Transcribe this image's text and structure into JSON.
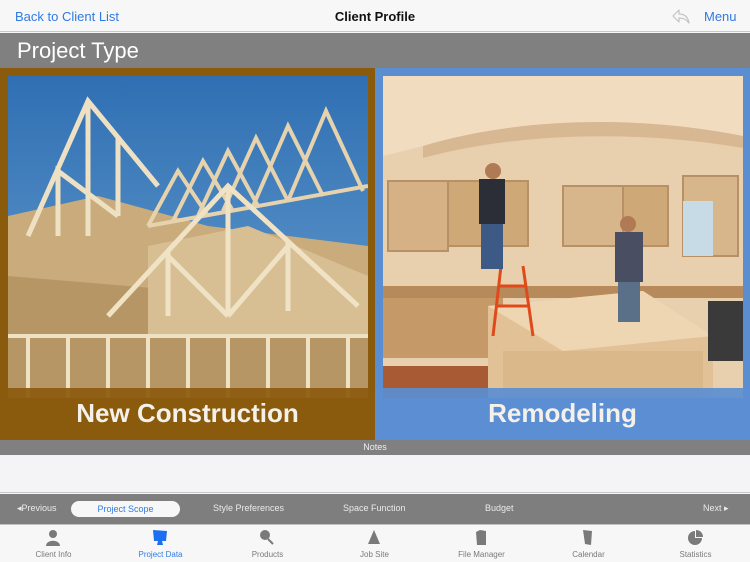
{
  "navbar": {
    "back_label": "Back to Client List",
    "title": "Client Profile",
    "undo_icon": "undo-arrow-icon",
    "menu_label": "Menu"
  },
  "section": {
    "title": "Project Type"
  },
  "choices": [
    {
      "label": "New Construction",
      "image": "house-framing-photo",
      "color": "#8a5a0d"
    },
    {
      "label": "Remodeling",
      "image": "kitchen-remodel-photo",
      "color": "#5b8ed1"
    }
  ],
  "notes": {
    "label": "Notes",
    "value": ""
  },
  "subnav": {
    "previous_label": "◂Previous",
    "items": [
      "Project Scope",
      "Style Preferences",
      "Space Function",
      "Budget"
    ],
    "active_index": 0,
    "next_label": "Next ▸"
  },
  "tabbar": {
    "items": [
      {
        "label": "Client Info",
        "icon": "person-icon"
      },
      {
        "label": "Project Data",
        "icon": "monitor-icon"
      },
      {
        "label": "Products",
        "icon": "magnifier-icon"
      },
      {
        "label": "Job Site",
        "icon": "cone-icon"
      },
      {
        "label": "File Manager",
        "icon": "clipboard-icon"
      },
      {
        "label": "Calendar",
        "icon": "calendar-page-icon"
      },
      {
        "label": "Statistics",
        "icon": "pie-chart-icon"
      }
    ],
    "active_index": 1
  },
  "colors": {
    "accent": "#2f7ae5",
    "header_gray": "#808080",
    "new_construction": "#8a5a0d",
    "remodeling": "#5b8ed1"
  }
}
